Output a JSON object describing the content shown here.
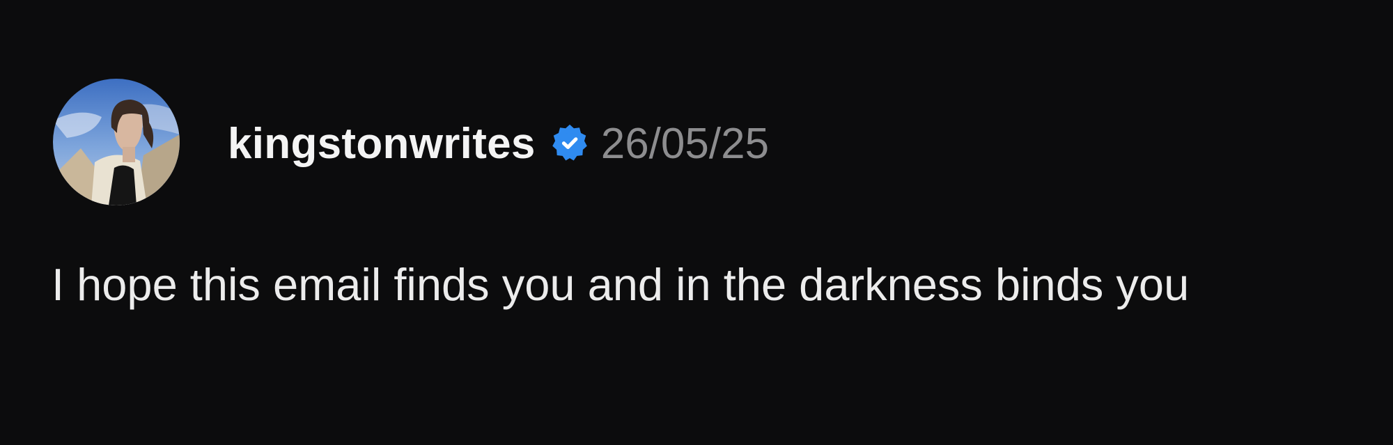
{
  "post": {
    "username": "kingstonwrites",
    "timestamp": "26/05/25",
    "text": "I hope this email finds you and in the darkness binds you",
    "avatar_icon": "profile-photo-avatar",
    "badge_icon": "verified-badge-icon"
  },
  "colors": {
    "background": "#0c0c0d",
    "username": "#f4f4f4",
    "timestamp": "#8d8d8f",
    "body_text": "#ececec",
    "verified_badge": "#2f8bf0"
  }
}
